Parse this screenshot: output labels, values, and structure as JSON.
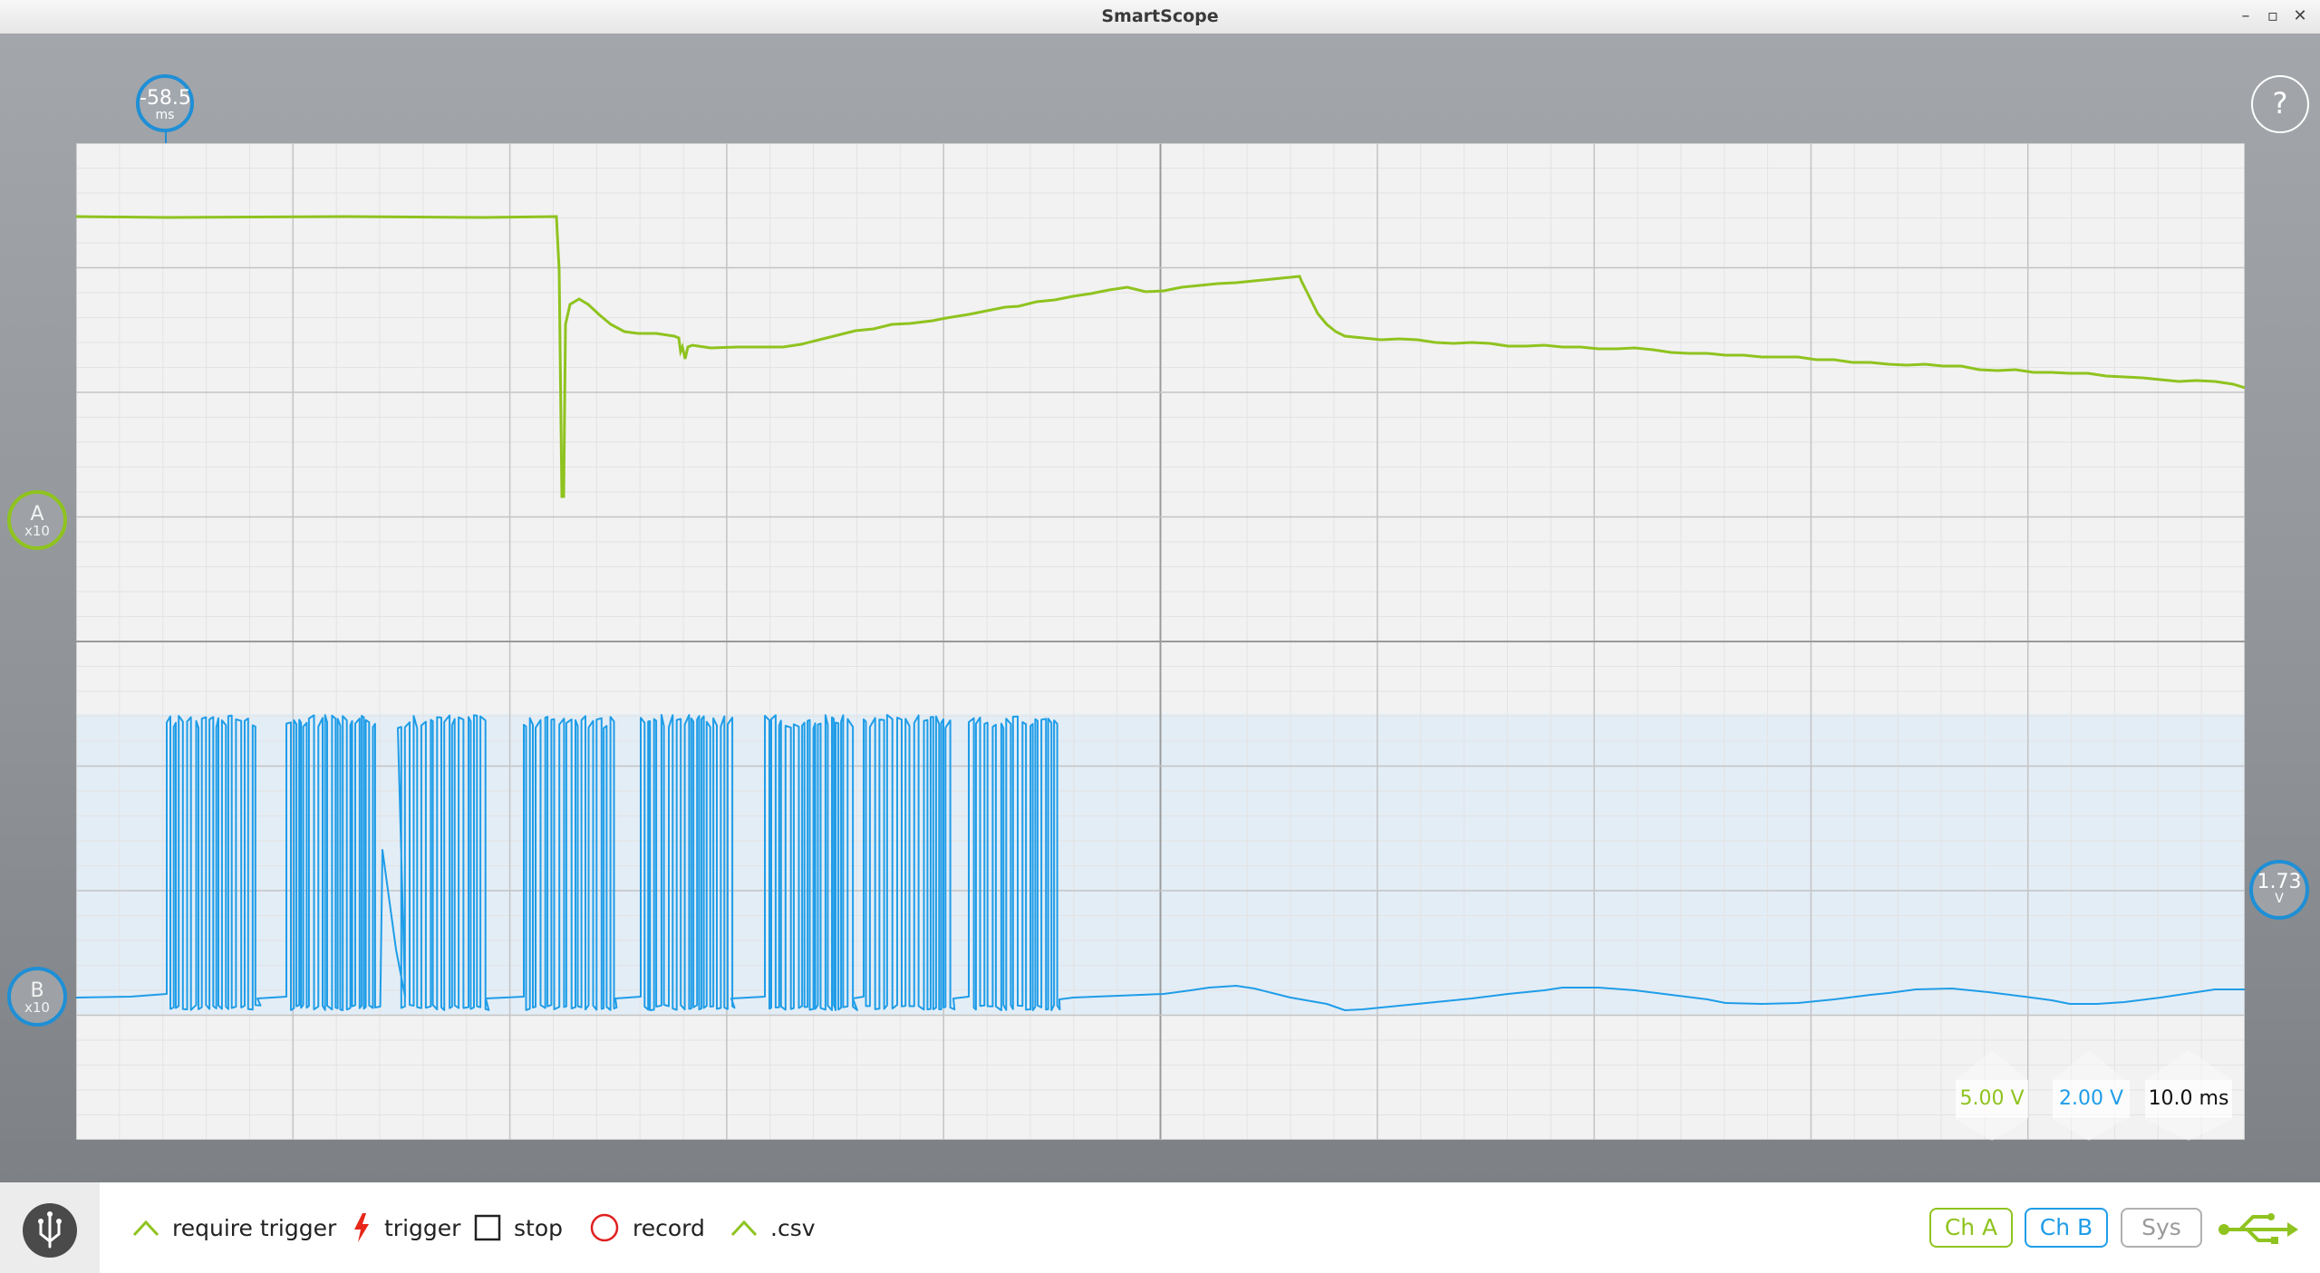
{
  "window": {
    "title": "SmartScope"
  },
  "markers": {
    "time": {
      "value": "-58.5",
      "unit": "ms"
    },
    "channel_a": {
      "label": "A",
      "probe": "x10"
    },
    "channel_b": {
      "label": "B",
      "probe": "x10"
    },
    "trigger_level": {
      "value": "1.73",
      "unit": "V"
    },
    "help": "?"
  },
  "scales": {
    "channel_a": "5.00 V",
    "channel_b": "2.00 V",
    "timebase": "10.0 ms"
  },
  "toolbar": {
    "require_trigger": "require trigger",
    "trigger": "trigger",
    "stop": "stop",
    "record": "record",
    "csv": ".csv"
  },
  "channel_buttons": {
    "ch_a": "Ch A",
    "ch_b": "Ch B",
    "sys": "Sys"
  },
  "colors": {
    "channel_a": "#8fc31f",
    "channel_b": "#1f9de8",
    "trigger_red": "#e8261a",
    "record_red": "#e02020",
    "grid": "#c9c9c9",
    "grid_minor": "#e3e3e3",
    "plot_bg": "#f2f2f2",
    "usb_green": "#8fc31f"
  },
  "icons": {
    "require_trigger": "rising-edge-icon",
    "trigger": "lightning-icon",
    "stop": "square-icon",
    "record": "circle-icon",
    "csv": "rising-edge-icon",
    "usb": "usb-icon",
    "logo": "smartscope-logo-icon",
    "help": "question-icon"
  }
}
